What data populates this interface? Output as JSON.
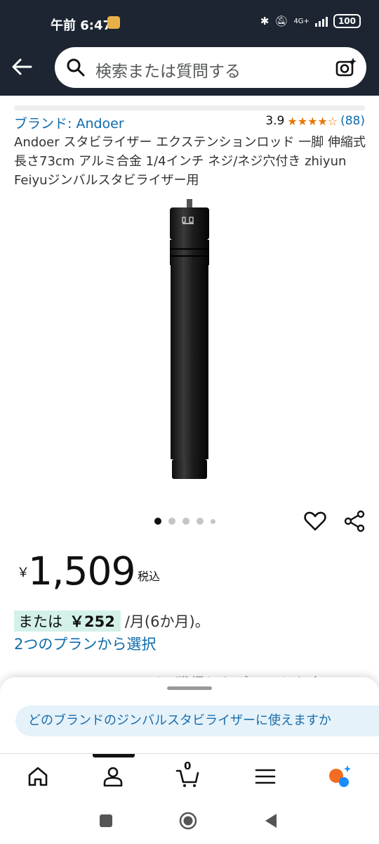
{
  "status_bar": {
    "time": "午前 6:47",
    "battery": "100",
    "network": "4G+"
  },
  "search": {
    "placeholder": "検索または質問する"
  },
  "product": {
    "brand_link": "ブランド: Andoer",
    "rating_value": "3.9",
    "stars": "★★★★☆",
    "review_count": "(88)",
    "title": "Andoer スタビライザー エクステンションロッド 一脚 伸縮式 長さ73cm アルミ合金 1/4インチ ネジ/ネジ穴付き zhiyun Feiyuジンバルスタビライザー用",
    "image_count": 5,
    "active_image": 1
  },
  "price": {
    "symbol": "￥",
    "value": "1,509",
    "tax_label": "税込",
    "installment_prefix": "または",
    "installment_amount": "￥252",
    "installment_suffix": "/月(6か月)。",
    "plan_link": "2つのプランから選択",
    "obscured_text": "Amazon Mastercardで獲得したポイントを今"
  },
  "sheet": {
    "suggestion": "どのブランドのジンバルスタビライザーに使えますか"
  },
  "nav": {
    "cart_count": "0",
    "items": [
      "home-icon",
      "account-icon",
      "cart-icon",
      "menu-icon",
      "rufus-icon"
    ]
  },
  "colors": {
    "header_bg": "#1c2531",
    "link": "#0f6bab",
    "star": "#e77600",
    "installment_highlight": "#d4f1e9"
  }
}
